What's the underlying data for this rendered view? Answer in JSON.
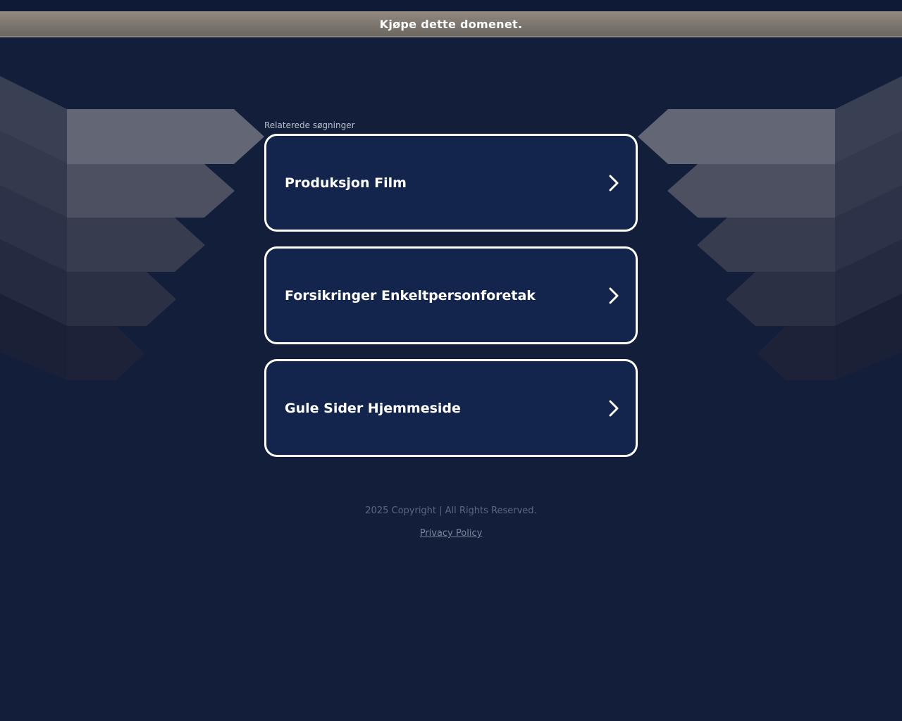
{
  "banner": {
    "buy_domain_label": "Kjøpe dette domenet."
  },
  "related": {
    "label": "Relaterede søgninger",
    "items": [
      {
        "label": "Produksjon Film",
        "icon": "chevron-right-icon"
      },
      {
        "label": "Forsikringer Enkeltpersonforetak",
        "icon": "chevron-right-icon"
      },
      {
        "label": "Gule Sider Hjemmeside",
        "icon": "chevron-right-icon"
      }
    ]
  },
  "footer": {
    "copyright": "2025 Copyright | All Rights Reserved.",
    "privacy_label": "Privacy Policy"
  },
  "colors": {
    "background": "#131f3a",
    "card_background": "#13254c",
    "card_border": "#ffffff",
    "buy_bar": "#7f7970"
  }
}
